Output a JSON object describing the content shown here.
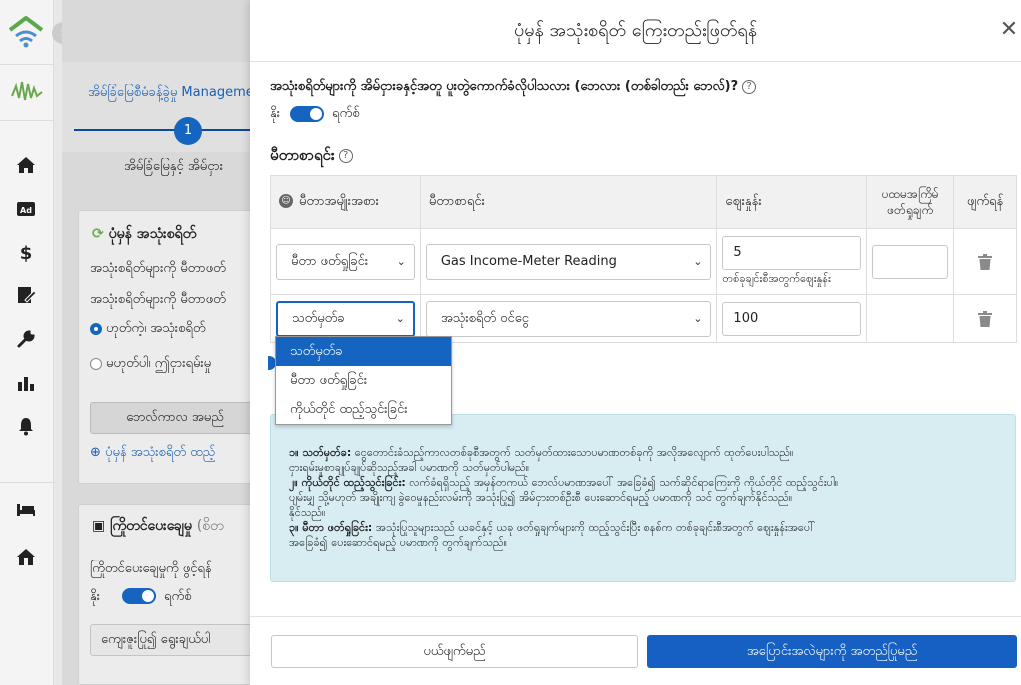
{
  "background": {
    "tab_label": "အိမ်ခြံမြေစီမံခန့်ခွဲမှု Management M",
    "step_number": "1",
    "step_label": "အိမ်ခြံမြေနှင့် အိမ်ငှား",
    "card1_title": "ပုံမှန် အသုံးစရိတ်",
    "card1_line1": "အသုံးစရိတ်များကို မီတာဖတ်",
    "card1_line2": "အသုံးစရိတ်များကို မီတာဖတ်",
    "radio_yes": "ဟုတ်ကဲ့၊ အသုံးစရိတ်",
    "radio_no": "မဟုတ်ပါ၊ ဤငှားရမ်းမှု",
    "period_button": "ဘေလ်ကာလ အမည်",
    "add_link": "ပုံမှန် အသုံးစရိတ် ထည့်",
    "card2_title": "ကြိုတင်ပေးချေမှု",
    "card2_suffix": "(စိတ",
    "card2_line": "ကြိုတင်ပေးချေမှုကို ဖွင့်ရန်",
    "yes": "နိုး",
    "no": "ရက်စ်",
    "select_placeholder": "ကျေးဇူးပြု၍ ရွေးချယ်ပါ"
  },
  "dialog": {
    "title": "ပုံမှန် အသုံးစရိတ် ကြေးတည်းဖြတ်ရန်",
    "question": "အသုံးစရိတ်များကို အိမ်ငှားခနှင့်အတူ ပူးတွဲကောက်ခံလိုပါသလား (ဘေလား (တစ်ခါတည်း ဘေလ်)?",
    "toggle_yes": "နိုး",
    "toggle_no": "ရက်စ်",
    "section_title": "မီတာစာရင်း"
  },
  "table": {
    "headers": [
      "မီတာအမျိုးအစား",
      "မီတာစာရင်း",
      "ဈေးနှုန်း",
      "ပထမအကြိမ် ဖတ်ရှုချက်",
      "ဖျက်ရန်"
    ],
    "rows": [
      {
        "type": "မီတာ ဖတ်ရှုခြင်း",
        "meter": "Gas Income-Meter Reading",
        "price": "5",
        "hint": "တစ်ခုချင်းစီအတွက်ဈေးနှုန်း",
        "first_reading": ""
      },
      {
        "type": "သတ်မှတ်ခ",
        "meter": "အသုံးစရိတ် ဝင်ငွေ",
        "price": "100",
        "hint": "",
        "first_reading": ""
      }
    ]
  },
  "dropdown": {
    "options": [
      "သတ်မှတ်ခ",
      "မီတာ ဖတ်ရှုခြင်း",
      "ကိုယ်တိုင် ထည့်သွင်းခြင်း"
    ],
    "selected_index": 0
  },
  "info": {
    "l1_bold": "၁။ သတ်မှတ်ခ:",
    "l1": " ငွေတောင်းခံသည့်ကာလတစ်ခုစီအတွက် သတ်မှတ်ထားသောပမာဏတစ်ခုကို အလိုအလျောက် ထုတ်ပေးပါသည်။",
    "l1b": "ငှားရမ်းမှုစာချုပ်ချုပ်ဆိုသည့်အခါ ပမာဏကို သတ်မှတ်ပါမည်။",
    "l2_bold": "၂။ ကိုယ်တိုင် ထည့်သွင်းခြင်း:",
    "l2": " လက်ခံရရှိသည့် အမှန်တကယ် ဘေလ်ပမာဏအပေါ် အခြေခံ၍ သက်ဆိုင်ရာကြေးကို ကိုယ်တိုင် ထည့်သွင်းပါ။",
    "l2b": "ပျမ်းမျှ သို့မဟုတ် အချိုးကျ ခွဲဝေမှုနည်းလမ်းကို အသုံးပြု၍ အိမ်ငှားတစ်ဦးစီ ပေးဆောင်ရမည့် ပမာဏကို သင် တွက်ချက်နိုင်သည်။",
    "l2c": "နိုင်သည်။",
    "l3_bold": "၃။ မီတာ ဖတ်ရှုခြင်း:",
    "l3": " အသုံးပြုသူများသည် ယခင်နှင့် ယခု ဖတ်ရှုချက်များကို ထည့်သွင်းပြီး စနစ်က တစ်ခုချင်းစီအတွက် ဈေးနှုန်းအပေါ်",
    "l3b": "အခြေခံ၍ ပေးဆောင်ရမည့် ပမာဏကို တွက်ချက်သည်။"
  },
  "footer": {
    "cancel": "ပယ်ဖျက်မည်",
    "save": "အပြောင်းအလဲများကို အတည်ပြုမည်"
  },
  "colors": {
    "primary": "#1565c0",
    "info_bg": "#d7edf2",
    "logo_green": "#4caf50"
  }
}
